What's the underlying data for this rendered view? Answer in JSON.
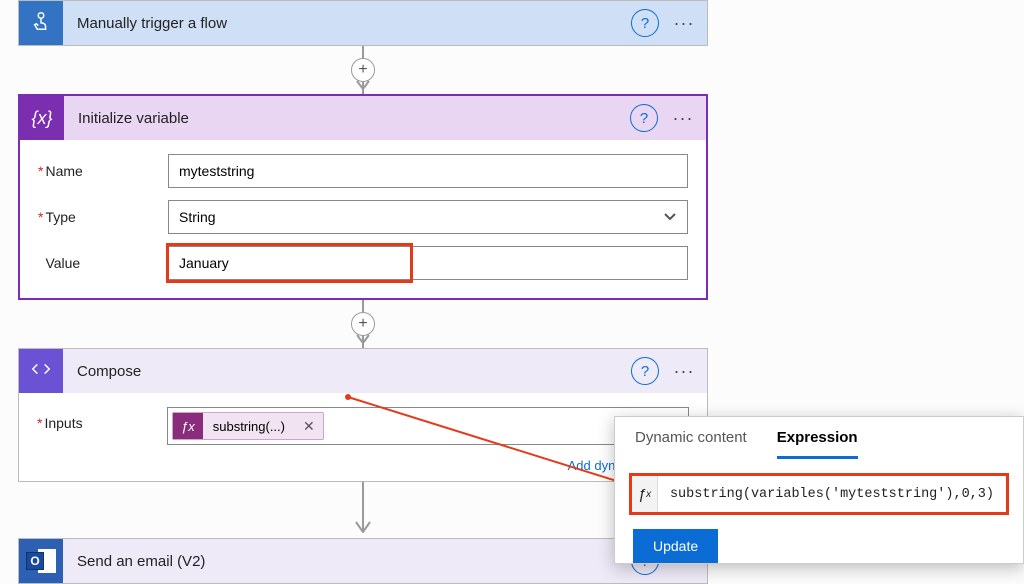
{
  "trigger": {
    "title": "Manually trigger a flow"
  },
  "init": {
    "title": "Initialize variable",
    "fields": {
      "name_label": "Name",
      "name_value": "myteststring",
      "type_label": "Type",
      "type_value": "String",
      "value_label": "Value",
      "value_value": "January"
    }
  },
  "compose": {
    "title": "Compose",
    "inputs_label": "Inputs",
    "token_label": "substring(...)",
    "add_dynamic_label": "Add dynamic content"
  },
  "email": {
    "title": "Send an email (V2)"
  },
  "popover": {
    "tab_dynamic": "Dynamic content",
    "tab_expression": "Expression",
    "expression": "substring(variables('myteststring'),0,3)",
    "update_label": "Update"
  },
  "glyphs": {
    "help": "?",
    "more": "···",
    "plus": "+",
    "close": "✕",
    "fx": "ƒx",
    "fx2": "ƒ"
  }
}
